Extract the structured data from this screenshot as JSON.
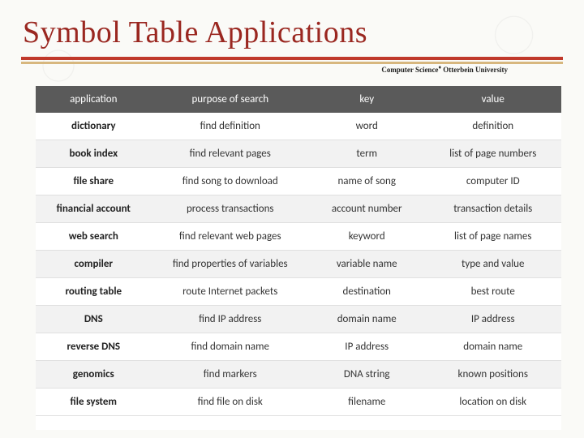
{
  "title": "Symbol Table Applications",
  "affiliation_prefix": "Computer Science",
  "affiliation_suffix": "Otterbein University",
  "affiliation_sep": "♦",
  "table": {
    "headers": [
      "application",
      "purpose of search",
      "key",
      "value"
    ],
    "rows": [
      {
        "app": "dictionary",
        "purpose": "find definition",
        "key": "word",
        "value": "definition"
      },
      {
        "app": "book index",
        "purpose": "find relevant pages",
        "key": "term",
        "value": "list of page numbers"
      },
      {
        "app": "file share",
        "purpose": "find song to download",
        "key": "name of song",
        "value": "computer ID"
      },
      {
        "app": "financial account",
        "purpose": "process transactions",
        "key": "account number",
        "value": "transaction details"
      },
      {
        "app": "web search",
        "purpose": "find relevant web pages",
        "key": "keyword",
        "value": "list of page names"
      },
      {
        "app": "compiler",
        "purpose": "find properties of variables",
        "key": "variable name",
        "value": "type and value"
      },
      {
        "app": "routing table",
        "purpose": "route Internet packets",
        "key": "destination",
        "value": "best route"
      },
      {
        "app": "DNS",
        "purpose": "find IP address",
        "key": "domain name",
        "value": "IP address"
      },
      {
        "app": "reverse DNS",
        "purpose": "find domain name",
        "key": "IP address",
        "value": "domain name"
      },
      {
        "app": "genomics",
        "purpose": "find markers",
        "key": "DNA string",
        "value": "known positions"
      },
      {
        "app": "file system",
        "purpose": "find file on disk",
        "key": "filename",
        "value": "location on disk"
      }
    ]
  }
}
